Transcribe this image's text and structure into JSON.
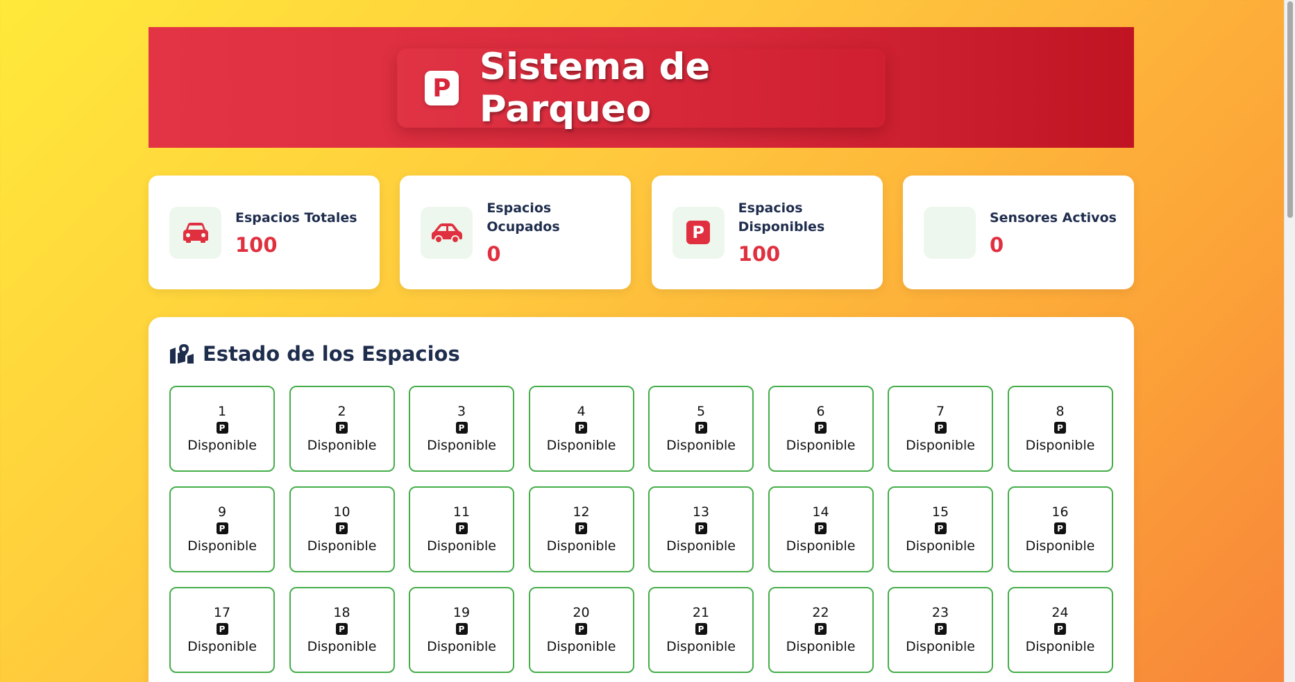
{
  "header": {
    "logo_letter": "P",
    "title": "Sistema de Parqueo"
  },
  "stats": [
    {
      "label": "Espacios Totales",
      "value": "100",
      "icon": "car-icon"
    },
    {
      "label": "Espacios Ocupados",
      "value": "0",
      "icon": "car-side-icon"
    },
    {
      "label": "Espacios Disponibles",
      "value": "100",
      "icon": "parking-icon",
      "icon_letter": "P"
    },
    {
      "label": "Sensores Activos",
      "value": "0",
      "icon": "sensor-icon"
    }
  ],
  "spaces": {
    "title": "Estado de los Espacios",
    "title_icon": "map-icon",
    "slot_icon_letter": "P",
    "items": [
      {
        "number": "1",
        "status": "Disponible"
      },
      {
        "number": "2",
        "status": "Disponible"
      },
      {
        "number": "3",
        "status": "Disponible"
      },
      {
        "number": "4",
        "status": "Disponible"
      },
      {
        "number": "5",
        "status": "Disponible"
      },
      {
        "number": "6",
        "status": "Disponible"
      },
      {
        "number": "7",
        "status": "Disponible"
      },
      {
        "number": "8",
        "status": "Disponible"
      },
      {
        "number": "9",
        "status": "Disponible"
      },
      {
        "number": "10",
        "status": "Disponible"
      },
      {
        "number": "11",
        "status": "Disponible"
      },
      {
        "number": "12",
        "status": "Disponible"
      },
      {
        "number": "13",
        "status": "Disponible"
      },
      {
        "number": "14",
        "status": "Disponible"
      },
      {
        "number": "15",
        "status": "Disponible"
      },
      {
        "number": "16",
        "status": "Disponible"
      },
      {
        "number": "17",
        "status": "Disponible"
      },
      {
        "number": "18",
        "status": "Disponible"
      },
      {
        "number": "19",
        "status": "Disponible"
      },
      {
        "number": "20",
        "status": "Disponible"
      },
      {
        "number": "21",
        "status": "Disponible"
      },
      {
        "number": "22",
        "status": "Disponible"
      },
      {
        "number": "23",
        "status": "Disponible"
      },
      {
        "number": "24",
        "status": "Disponible"
      }
    ]
  },
  "colors": {
    "brand_red": "#e0303f",
    "available_green": "#43ad48",
    "heading_navy": "#1f2d4d"
  }
}
